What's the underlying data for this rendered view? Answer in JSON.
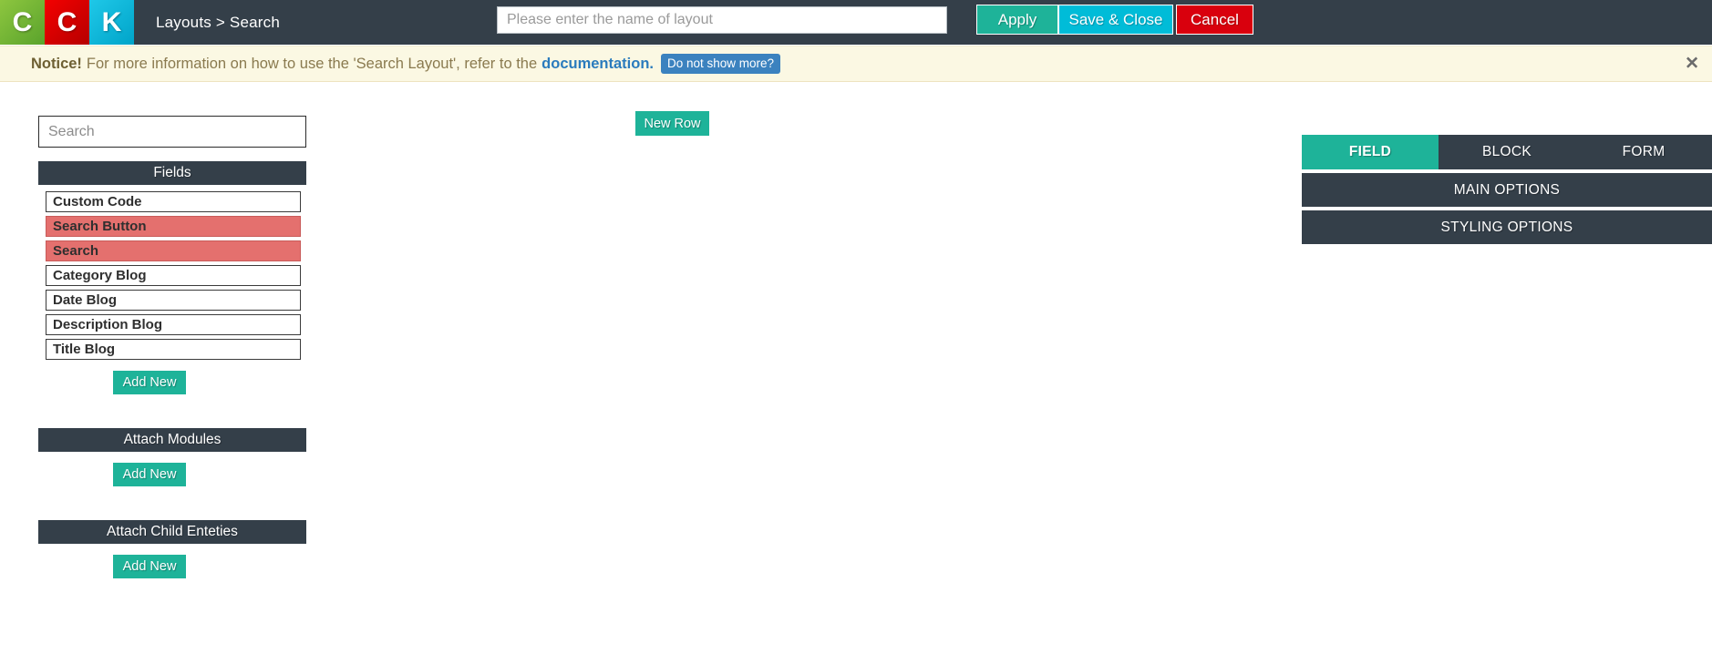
{
  "topbar": {
    "logo_tiles": [
      "C",
      "C",
      "K"
    ],
    "breadcrumb": "Layouts > Search",
    "layout_name_value": "",
    "layout_name_placeholder": "Please enter the name of layout",
    "apply_label": "Apply",
    "save_close_label": "Save & Close",
    "cancel_label": "Cancel",
    "colors": {
      "bar_bg": "#343f49",
      "apply": "#1eb399",
      "save_close": "#00bcd8",
      "cancel": "#d9000d"
    }
  },
  "notice": {
    "strong": "Notice!",
    "body": "For more information on how to use the 'Search Layout', refer to the",
    "link": "documentation.",
    "dismiss_label": "Do not show more?",
    "close_icon": "✕",
    "colors": {
      "bg": "#fbf8e3",
      "text": "#8a7a4f",
      "link": "#2a7bbd",
      "button": "#3b82bf"
    }
  },
  "sidebar": {
    "search": {
      "value": "",
      "placeholder": "Search"
    },
    "fields_header": "Fields",
    "fields": [
      {
        "label": "Custom Code",
        "selected": false
      },
      {
        "label": "Search Button",
        "selected": true
      },
      {
        "label": "Search",
        "selected": true
      },
      {
        "label": "Category Blog",
        "selected": false
      },
      {
        "label": "Date Blog",
        "selected": false
      },
      {
        "label": "Description Blog",
        "selected": false
      },
      {
        "label": "Title Blog",
        "selected": false
      }
    ],
    "fields_add_new": "Add New",
    "attach_modules_header": "Attach Modules",
    "attach_modules_add_new": "Add New",
    "attach_child_header": "Attach Child Enteties",
    "attach_child_add_new": "Add New",
    "colors": {
      "header_bg": "#343f49",
      "selected_bg": "#e4706e",
      "add_new_bg": "#1eb399"
    }
  },
  "canvas": {
    "new_row_label": "New Row"
  },
  "right_panel": {
    "tabs": [
      {
        "label": "FIELD",
        "active": true
      },
      {
        "label": "BLOCK",
        "active": false
      },
      {
        "label": "FORM",
        "active": false
      }
    ],
    "sections": [
      {
        "label": "MAIN OPTIONS"
      },
      {
        "label": "STYLING OPTIONS"
      }
    ],
    "colors": {
      "tab_bg": "#343f49",
      "tab_active_bg": "#1eb399"
    }
  }
}
